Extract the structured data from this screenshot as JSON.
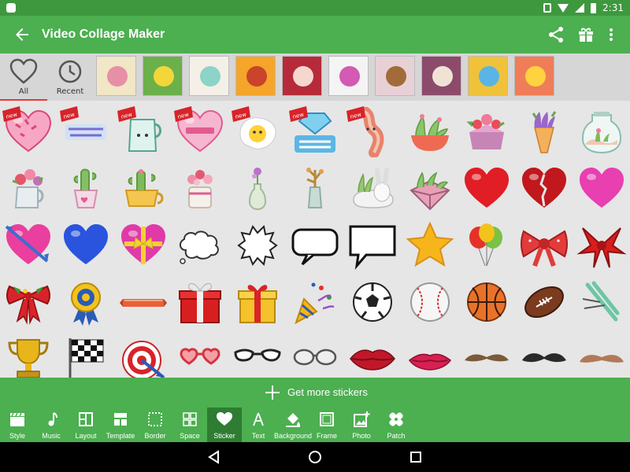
{
  "status": {
    "time": "2:31"
  },
  "app": {
    "title": "Video Collage Maker"
  },
  "categories": {
    "tabs": [
      {
        "label": "All",
        "icon": "heart-outline-icon",
        "active": true
      },
      {
        "label": "Recent",
        "icon": "clock-icon",
        "active": false
      }
    ],
    "thumbnails": [
      {
        "name": "thumb-floral-wreath"
      },
      {
        "name": "thumb-whats-up"
      },
      {
        "name": "thumb-omg-like"
      },
      {
        "name": "thumb-kiss-girl"
      },
      {
        "name": "thumb-red-circle"
      },
      {
        "name": "thumb-happy-birthday"
      },
      {
        "name": "thumb-party-kids"
      },
      {
        "name": "thumb-best-friends-forever"
      },
      {
        "name": "thumb-colorful-icons"
      },
      {
        "name": "thumb-emoji-collage"
      }
    ]
  },
  "stickers": {
    "new_badge": "new",
    "rows": [
      [
        "heart-pink-new",
        "text-sticker-new",
        "milk-jug-new",
        "shopping-heart-new",
        "fried-egg-new",
        "bling-bling-new",
        "bacon-new",
        "succulent-bowl",
        "flower-box",
        "flower-cone",
        "terrarium-jar"
      ],
      [
        "flower-pitcher",
        "cactus-pot-heart",
        "cactus-teacup",
        "flower-jar",
        "vase-flower",
        "plant-vase",
        "bunny-plant",
        "geometric-planter",
        "red-heart",
        "broken-heart",
        "pink-heart"
      ],
      [
        "heart-arrow",
        "blue-heart",
        "heart-ribbon",
        "cloud-bubble",
        "spiky-bubble",
        "speech-bubble",
        "square-bubble",
        "gold-star",
        "balloons",
        "red-bow",
        "red-gift-bow"
      ],
      [
        "christmas-bow",
        "award-ribbon",
        "banner-ribbon",
        "red-gift-box",
        "gold-gift-box",
        "party-popper",
        "soccer-ball",
        "baseball",
        "basketball",
        "football",
        "skis"
      ],
      [
        "trophy",
        "checkered-flag",
        "target",
        "heart-glasses",
        "cateye-glasses",
        "round-glasses",
        "lips",
        "lips-smile",
        "mustache-1",
        "mustache-2",
        "mustache-3"
      ]
    ]
  },
  "more_stickers": {
    "label": "Get more stickers"
  },
  "tools": [
    {
      "label": "Style",
      "icon": "clapper-icon"
    },
    {
      "label": "Music",
      "icon": "music-note-icon"
    },
    {
      "label": "Layout",
      "icon": "layout-icon"
    },
    {
      "label": "Template",
      "icon": "template-icon"
    },
    {
      "label": "Border",
      "icon": "border-icon"
    },
    {
      "label": "Space",
      "icon": "space-icon"
    },
    {
      "label": "Sticker",
      "icon": "heart-icon",
      "active": true
    },
    {
      "label": "Text",
      "icon": "text-icon"
    },
    {
      "label": "Background",
      "icon": "paint-bucket-icon"
    },
    {
      "label": "Frame",
      "icon": "frame-icon"
    },
    {
      "label": "Photo",
      "icon": "photo-add-icon"
    },
    {
      "label": "Patch",
      "icon": "bandage-icon"
    }
  ],
  "colors": {
    "primary": "#4caf50",
    "primary_dark": "#3e983e",
    "active_tool": "#2e7d32",
    "accent_red": "#e53935"
  }
}
